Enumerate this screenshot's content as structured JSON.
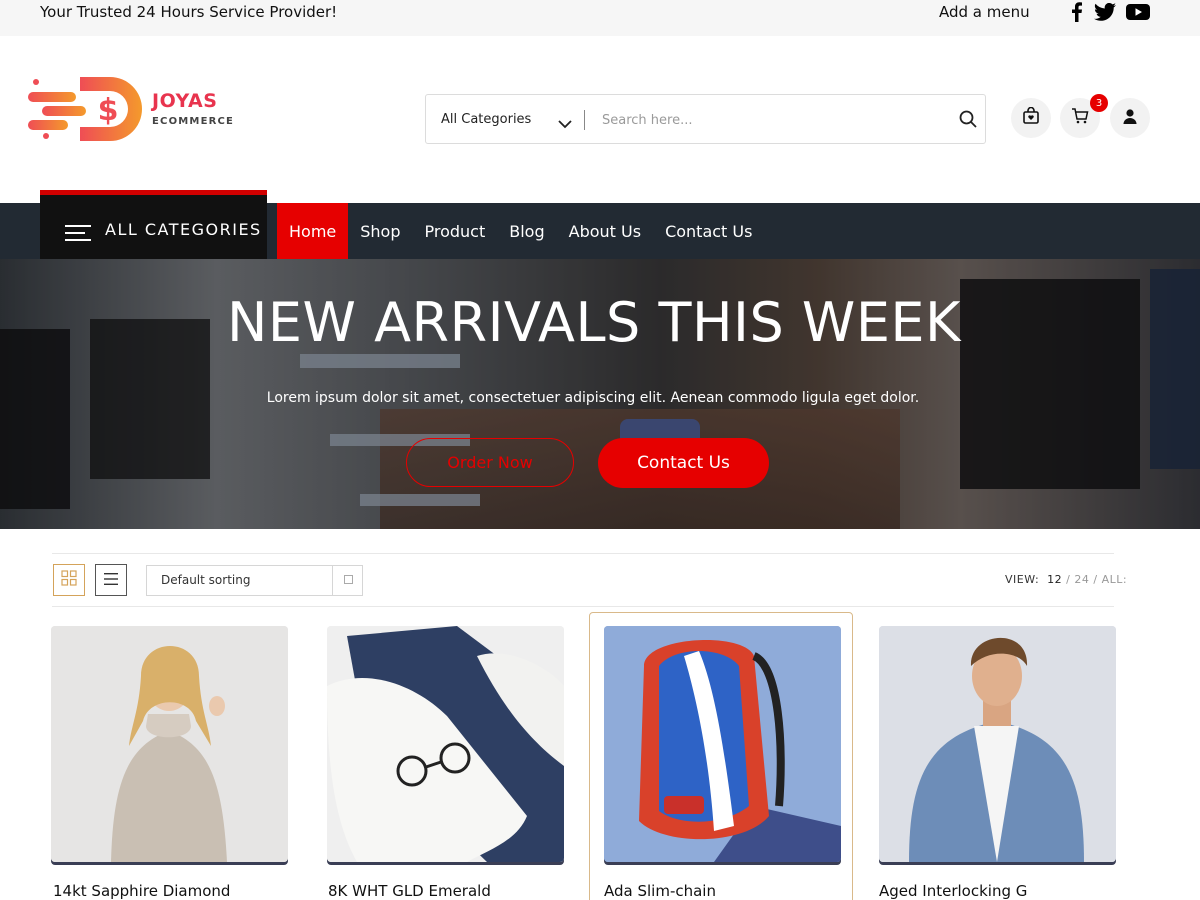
{
  "topbar": {
    "tagline": "Your Trusted 24 Hours Service Provider!",
    "add_menu": "Add a menu",
    "social_icons": [
      "facebook-icon",
      "twitter-icon",
      "youtube-icon"
    ]
  },
  "logo": {
    "brand": "JOYAS",
    "sub": "ECOMMERCE"
  },
  "search": {
    "category": "All Categories",
    "placeholder": "Search here..."
  },
  "header_icons": {
    "cart_count": "3"
  },
  "nav": {
    "all_categories": "ALL CATEGORIES",
    "links": [
      "Home",
      "Shop",
      "Product",
      "Blog",
      "About Us",
      "Contact Us"
    ],
    "active": "Home"
  },
  "hero": {
    "title": "NEW ARRIVALS THIS WEEK",
    "subtitle": "Lorem ipsum dolor sit amet, consectetuer adipiscing elit. Aenean commodo ligula eget dolor.",
    "btn_order": "Order Now",
    "btn_contact": "Contact Us"
  },
  "toolbar": {
    "sorting": "Default sorting",
    "view_label": "VIEW:",
    "view_12": "12",
    "view_sep": "/",
    "view_24": "24",
    "view_all": "ALL:"
  },
  "products": [
    {
      "name": "14kt Sapphire Diamond"
    },
    {
      "name": "8K WHT GLD Emerald"
    },
    {
      "name": "Ada Slim-chain"
    },
    {
      "name": "Aged Interlocking G"
    }
  ],
  "colors": {
    "accent": "#e60000",
    "nav_bg": "#222a33",
    "highlight_border": "#d9b98a"
  }
}
